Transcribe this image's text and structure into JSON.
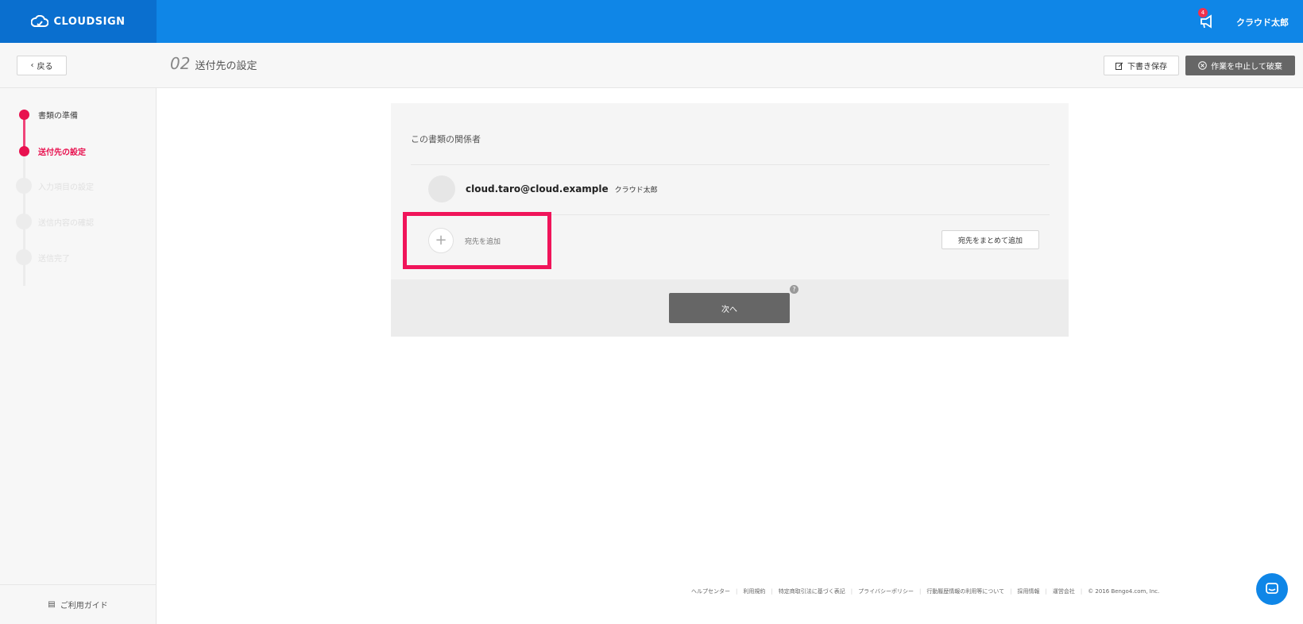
{
  "header": {
    "logo_text": "CLOUDSIGN",
    "notification_count": "4",
    "user_name": "クラウド太郎"
  },
  "subheader": {
    "back_label": "戻る",
    "step_number": "02",
    "step_title": "送付先の設定",
    "draft_label": "下書き保存",
    "discard_label": "作業を中止して破棄"
  },
  "sidebar": {
    "steps": [
      {
        "label": "書類の準備",
        "state": "done"
      },
      {
        "label": "送付先の設定",
        "state": "current"
      },
      {
        "label": "入力項目の設定",
        "state": "pending"
      },
      {
        "label": "送信内容の確認",
        "state": "pending"
      },
      {
        "label": "送信完了",
        "state": "pending"
      }
    ],
    "guide_label": "ご利用ガイド"
  },
  "main": {
    "section_title": "この書類の関係者",
    "participant": {
      "email": "cloud.taro@cloud.example",
      "name": "クラウド太郎"
    },
    "add_recipient_label": "宛先を追加",
    "bulk_add_label": "宛先をまとめて追加",
    "next_label": "次へ",
    "help_label": "?"
  },
  "footer": {
    "links": [
      "ヘルプセンター",
      "利用規約",
      "特定商取引法に基づく表記",
      "プライバシーポリシー",
      "行動履歴情報の利用等について",
      "採用情報",
      "運営会社"
    ],
    "copyright": "© 2016 Bengo4.com, Inc."
  },
  "colors": {
    "brand_blue": "#0f86e7",
    "accent_pink": "#e8114f",
    "highlight_pink": "#f0145a"
  }
}
